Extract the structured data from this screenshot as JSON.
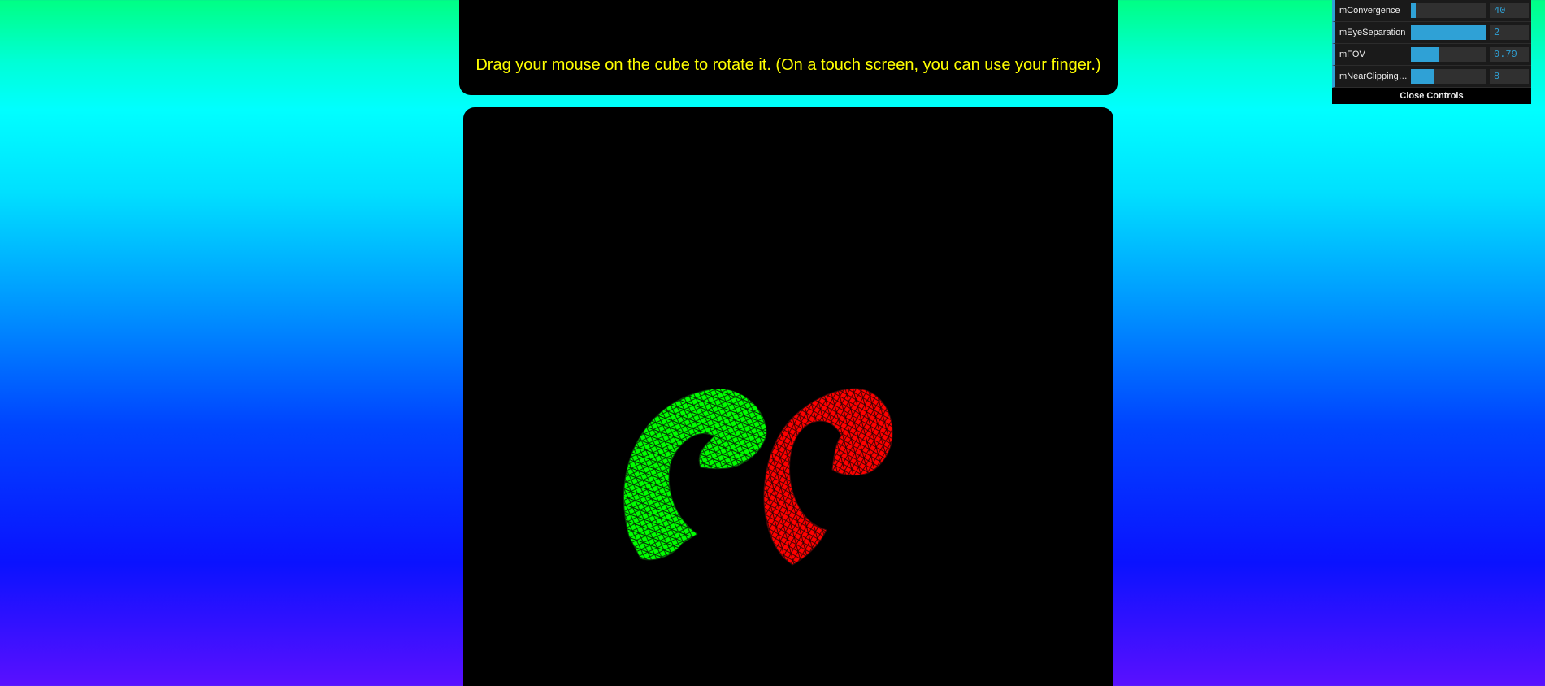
{
  "header": {
    "instruction": "Drag your mouse on the cube to rotate it. (On a touch screen, you can use your finger.)"
  },
  "scene": {
    "left_view_color": "#00ff00",
    "right_view_color": "#ff0000",
    "wire_color": "#000000"
  },
  "controls": {
    "items": [
      {
        "label": "mConvergence",
        "value": "40",
        "fill": 0.06
      },
      {
        "label": "mEyeSeparation",
        "value": "2",
        "fill": 1.0
      },
      {
        "label": "mFOV",
        "value": "0.79",
        "fill": 0.38
      },
      {
        "label": "mNearClippingD...",
        "value": "8",
        "fill": 0.3
      }
    ],
    "close_label": "Close Controls"
  },
  "colors": {
    "accent": "#2fa1d6",
    "instruction_text": "#ffff00",
    "panel_bg": "#000000"
  }
}
